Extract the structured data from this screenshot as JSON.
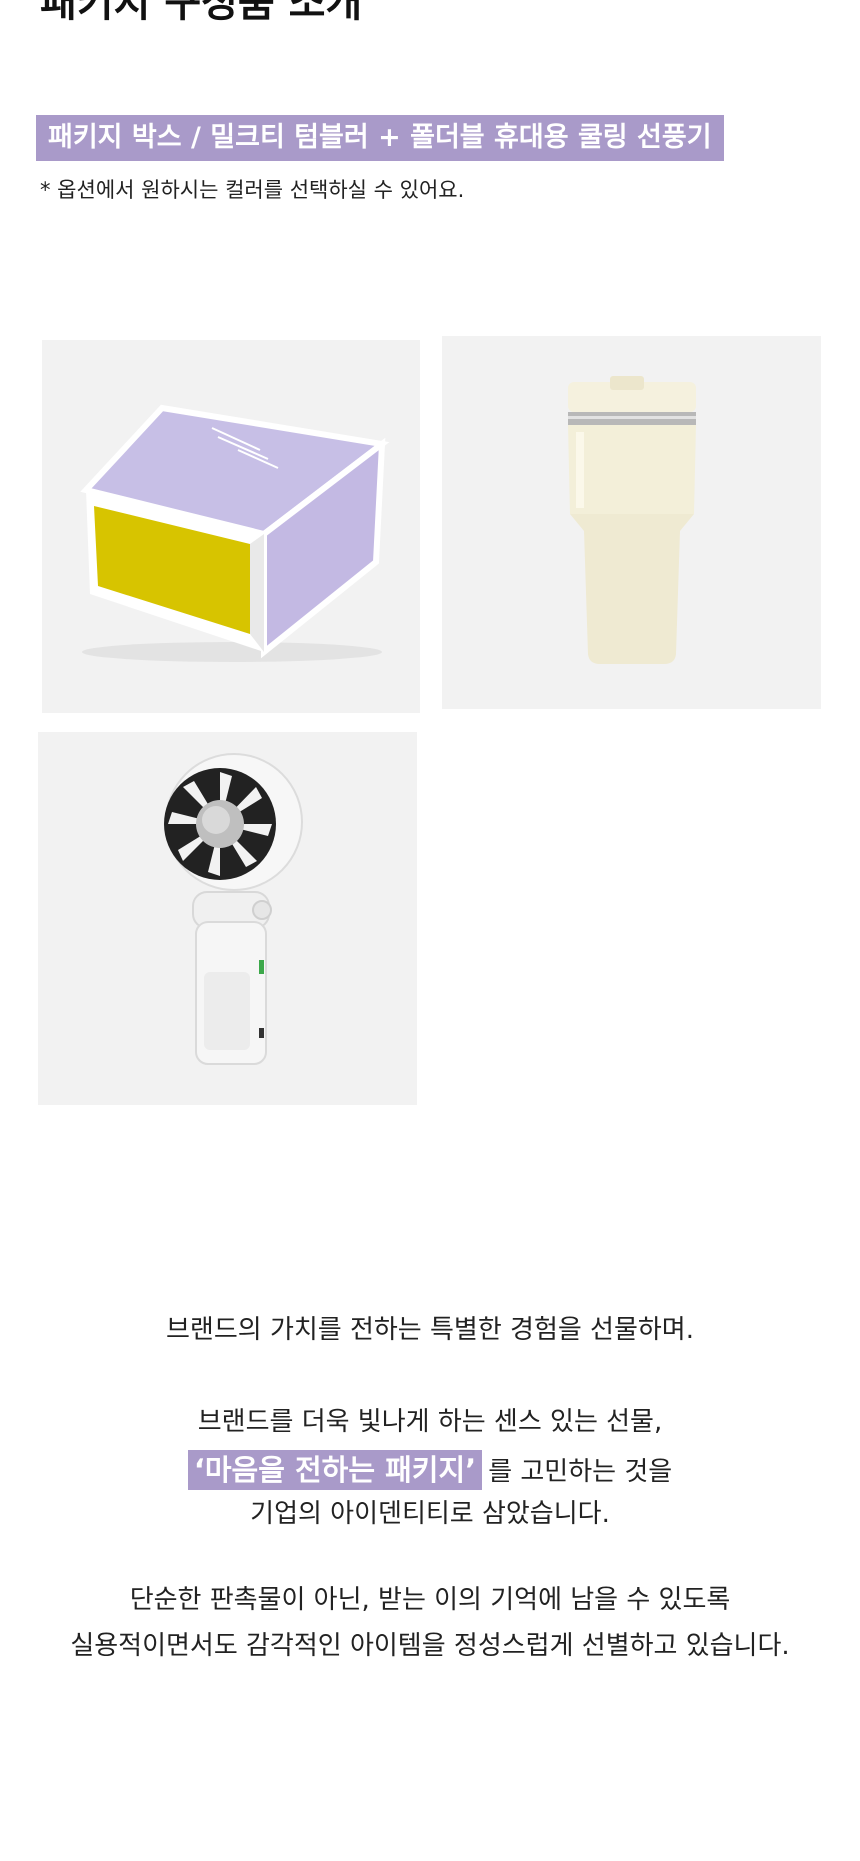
{
  "header": {
    "title": "패키지 구성품 소개"
  },
  "package": {
    "highlight_title": "패키지 박스 / 밀크티 텀블러 + 폴더블 휴대용 쿨링 선풍기",
    "option_note": "* 옵션에서 원하시는 컬러를 선택하실 수 있어요."
  },
  "products": [
    {
      "name": "패키지 박스",
      "image": "gift-box",
      "colors": {
        "lid": "#c7bfe6",
        "front": "#d7c400",
        "frame": "#ffffff"
      }
    },
    {
      "name": "밀크티 텀블러",
      "image": "tumbler",
      "colors": {
        "body": "#f3efd9",
        "band": "#b8b8b8"
      }
    },
    {
      "name": "폴더블 휴대용 쿨링 선풍기",
      "image": "handheld-fan",
      "colors": {
        "body": "#f6f6f6",
        "blades": "#2a2a2a"
      }
    }
  ],
  "message": {
    "line1": "브랜드의 가치를 전하는  특별한 경험을 선물하며.",
    "line2": "브랜드를 더욱 빛나게 하는 센스 있는 선물,",
    "highlight": "‘마음을 전하는 패키지’",
    "line3_rest": "를 고민하는 것을",
    "line4": "기업의 아이덴티티로 삼았습니다.",
    "line5": "단순한 판촉물이 아닌, 받는 이의 기억에 남을 수 있도록",
    "line6": "실용적이면서도 감각적인 아이템을 정성스럽게 선별하고 있습니다."
  },
  "theme": {
    "accent": "#a99ac9",
    "card_background": "#f2f2f2"
  }
}
